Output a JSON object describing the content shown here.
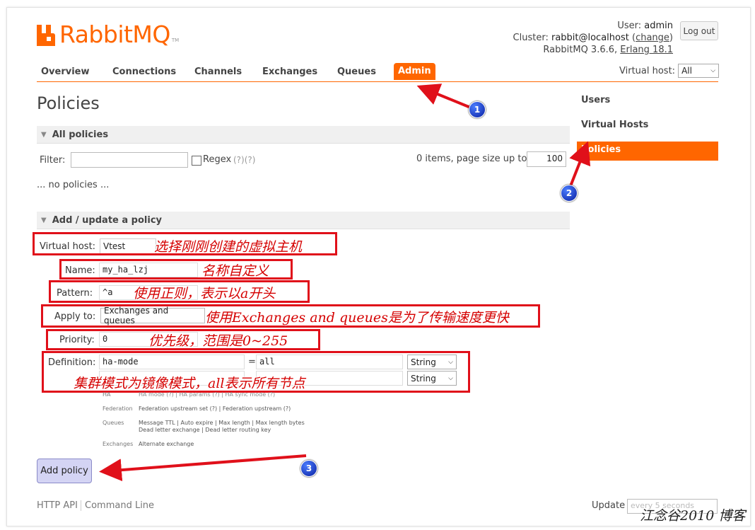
{
  "logo": {
    "text": "RabbitMQ",
    "tm": "TM"
  },
  "login": {
    "user_label": "User:",
    "user": "admin",
    "cluster_label": "Cluster:",
    "cluster": "rabbit@localhost",
    "change": "change",
    "version": "RabbitMQ 3.6.6,",
    "erlang": "Erlang 18.1",
    "logout": "Log out"
  },
  "nav": {
    "tabs": [
      "Overview",
      "Connections",
      "Channels",
      "Exchanges",
      "Queues",
      "Admin"
    ]
  },
  "vhost_select": {
    "label": "Virtual host:",
    "value": "All"
  },
  "page_title": "Policies",
  "side": {
    "items": [
      "Users",
      "Virtual Hosts",
      "Policies"
    ]
  },
  "all_policies": {
    "header": "All policies",
    "filter_label": "Filter:",
    "regex_label": "Regex",
    "regex_help": "(?)(?)",
    "items_text": "0 items, page size up to",
    "page_size": "100",
    "empty": "... no policies ..."
  },
  "add_policy": {
    "header": "Add / update a policy",
    "vhost_label": "Virtual host:",
    "vhost_value": "Vtest",
    "name_label": "Name:",
    "name_value": "my_ha_lzj",
    "pattern_label": "Pattern:",
    "pattern_value": "^a",
    "apply_label": "Apply to:",
    "apply_value": "Exchanges and queues",
    "priority_label": "Priority:",
    "priority_value": "0",
    "definition_label": "Definition:",
    "def_key": "ha-mode",
    "def_eq": "=",
    "def_value": "all",
    "type1": "String",
    "type2": "String",
    "help": {
      "ha_k": "HA",
      "ha_v": "HA mode (?) | HA params (?) | HA sync mode (?)",
      "fed_k": "Federation",
      "fed_v": "Federation upstream set (?) | Federation upstream (?)",
      "q_k": "Queues",
      "q_v1": "Message TTL | Auto expire | Max length | Max length bytes",
      "q_v2": "Dead letter exchange | Dead letter routing key",
      "ex_k": "Exchanges",
      "ex_v": "Alternate exchange"
    },
    "submit": "Add policy"
  },
  "annotations": {
    "vhost": "选择刚刚创建的虚拟主机",
    "name": "名称自定义",
    "pattern": "使用正则，表示以a开头",
    "apply": "使用Exchanges and queues是为了传输速度更快",
    "priority": "优先级，范围是0~255",
    "definition": "集群模式为镜像模式，all表示所有节点"
  },
  "markers": [
    "1",
    "2",
    "3"
  ],
  "footer": {
    "http_api": "HTTP API",
    "cmd": "Command Line",
    "update": "Update",
    "update_value": "every 5 seconds"
  },
  "watermark": "江念谷2010 博客",
  "colors": {
    "accent": "#ff6600",
    "annotation": "#e0101a"
  }
}
